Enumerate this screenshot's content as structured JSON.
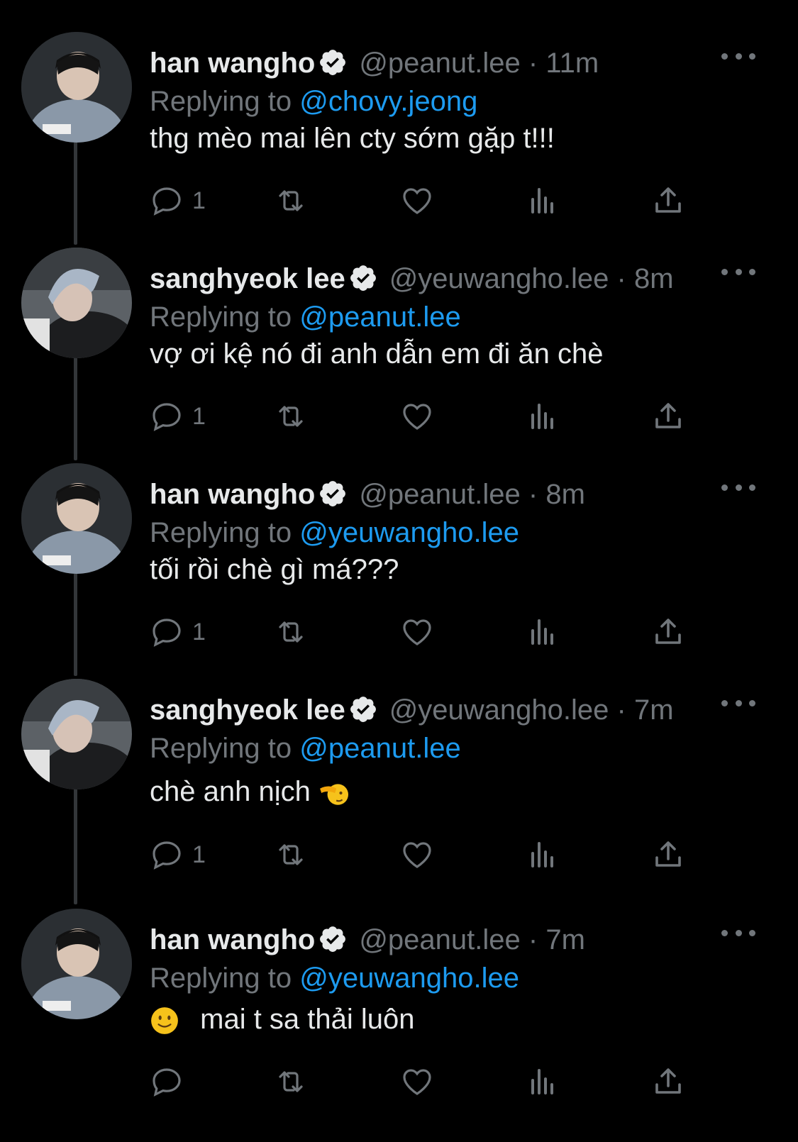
{
  "tweets": [
    {
      "name": "han wangho",
      "handle": "@peanut.lee",
      "separator": "·",
      "time": "11m",
      "reply_prefix": "Replying to",
      "reply_to": "@chovy.jeong",
      "text": "thg mèo mai lên cty sớm gặp t!!!",
      "reply_count": "1"
    },
    {
      "name": "sanghyeok lee",
      "handle": "@yeuwangho.lee",
      "separator": "·",
      "time": "8m",
      "reply_prefix": "Replying to",
      "reply_to": "@peanut.lee",
      "text": "vợ ơi kệ nó đi anh dẫn em đi ăn chè",
      "reply_count": "1"
    },
    {
      "name": "han wangho",
      "handle": "@peanut.lee",
      "separator": "·",
      "time": "8m",
      "reply_prefix": "Replying to",
      "reply_to": "@yeuwangho.lee",
      "text": "tối rồi chè gì má???",
      "reply_count": "1"
    },
    {
      "name": "sanghyeok lee",
      "handle": "@yeuwangho.lee",
      "separator": "·",
      "time": "7m",
      "reply_prefix": "Replying to",
      "reply_to": "@peanut.lee",
      "text": "chè anh nịch",
      "emoji": "saluting-face",
      "reply_count": "1"
    },
    {
      "name": "han wangho",
      "handle": "@peanut.lee",
      "separator": "·",
      "time": "7m",
      "reply_prefix": "Replying to",
      "reply_to": "@yeuwangho.lee",
      "emoji": "slightly-smiling-face",
      "text": "mai t sa thải luôn",
      "reply_count": ""
    }
  ],
  "icons": {
    "reply": "reply-icon",
    "retweet": "retweet-icon",
    "like": "like-icon",
    "views": "views-icon",
    "share": "share-icon",
    "verified": "verified-badge-icon",
    "more": "more-icon"
  },
  "colors": {
    "background": "#000000",
    "text": "#e7e9ea",
    "muted": "#71767b",
    "link": "#1d9bf0"
  }
}
